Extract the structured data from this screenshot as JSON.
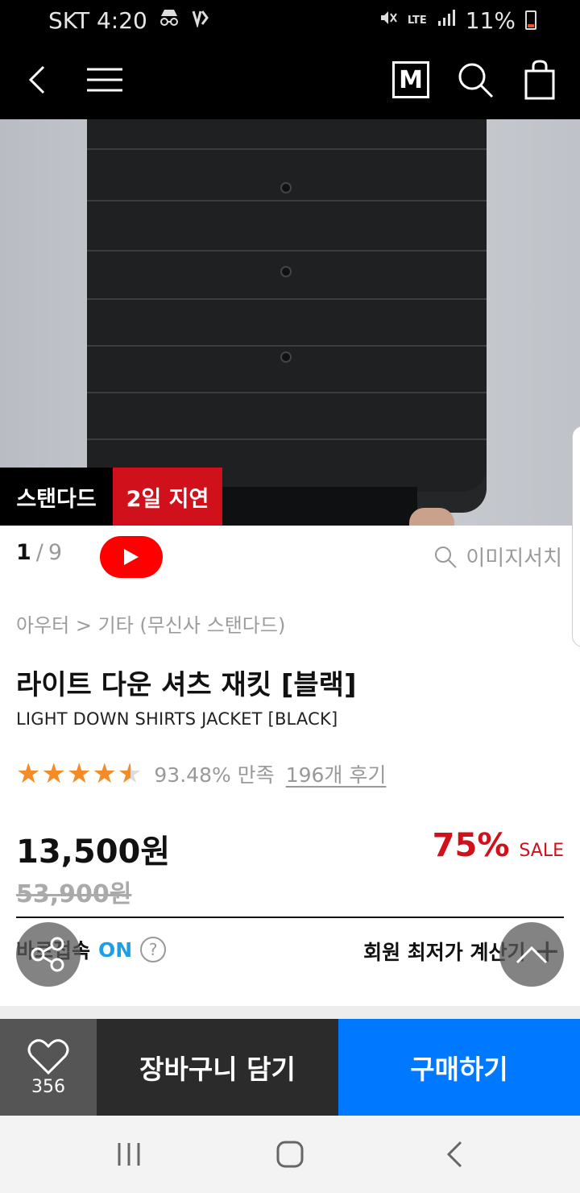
{
  "status_bar": {
    "carrier_time": "SKT 4:20",
    "network": "LTE",
    "battery": "11%"
  },
  "header": {
    "icons": [
      "back-arrow-icon",
      "menu-icon",
      "m-logo-icon",
      "search-icon",
      "shopping-bag-icon"
    ],
    "m_logo": "M"
  },
  "hero": {
    "badges": {
      "brand": "스탠다드",
      "delay": "2일 지연"
    },
    "colors": {
      "brand_badge": "#000000",
      "delay_badge": "#d0111b"
    }
  },
  "gallery": {
    "current": "1",
    "separator": "/",
    "total": "9",
    "image_search": "이미지서치"
  },
  "product": {
    "breadcrumb": "아우터 > 기타 (무신사 스탠다드)",
    "title_ko": "라이트 다운 셔츠 재킷 [블랙]",
    "title_en": "LIGHT DOWN SHIRTS JACKET [BLACK]",
    "rating": {
      "stars": 4.5,
      "max_stars": 5,
      "satisfaction": "93.48% 만족",
      "reviews": "196개 후기"
    },
    "price": "13,500원",
    "original_price": "53,900원",
    "discount_percent": "75%",
    "sale_label": "SALE",
    "sale_color": "#d0111b"
  },
  "options": {
    "direct_label": "바로접속",
    "direct_state": "ON",
    "help": "?",
    "member_price": "회원 최저가 계산기",
    "expand": "+"
  },
  "actions": {
    "like_count": "356",
    "cart": "장바구니 담기",
    "buy": "구매하기",
    "buy_color": "#0078ff"
  },
  "system_nav": {
    "icons": [
      "recents-icon",
      "home-icon",
      "back-icon"
    ]
  }
}
